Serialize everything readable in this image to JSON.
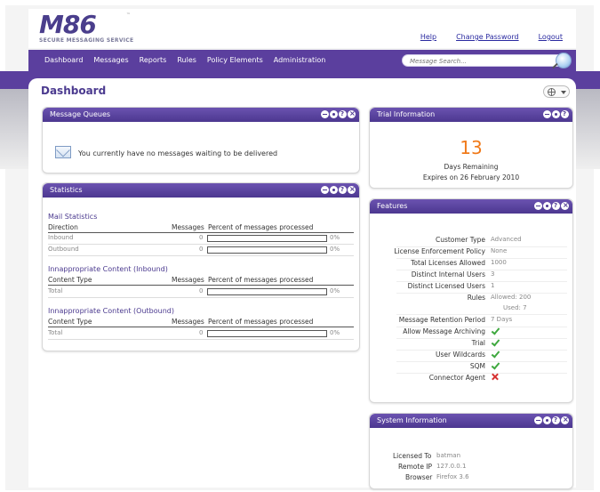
{
  "logo": {
    "mark": "M86",
    "tagline": "SECURE MESSAGING SERVICE",
    "tm": "™"
  },
  "top_links": {
    "help": "Help",
    "change_password": "Change Password",
    "logout": "Logout"
  },
  "nav": {
    "items": [
      "Dashboard",
      "Messages",
      "Reports",
      "Rules",
      "Policy Elements",
      "Administration"
    ],
    "search_placeholder": "Message Search..."
  },
  "page": {
    "title": "Dashboard"
  },
  "message_queues": {
    "title": "Message Queues",
    "message": "You currently have no messages waiting to be delivered"
  },
  "statistics": {
    "title": "Statistics",
    "mail": {
      "title": "Mail Statistics",
      "headers": {
        "direction": "Direction",
        "messages": "Messages",
        "percent": "Percent of messages processed"
      },
      "rows": [
        {
          "label": "Inbound",
          "messages": "0",
          "percent": 0,
          "percent_label": "0%"
        },
        {
          "label": "Outbound",
          "messages": "0",
          "percent": 0,
          "percent_label": "0%"
        }
      ]
    },
    "inbound_content": {
      "title": "Innappropriate Content (Inbound)",
      "headers": {
        "type": "Content Type",
        "messages": "Messages",
        "percent": "Percent of messages processed"
      },
      "rows": [
        {
          "label": "Total",
          "messages": "0",
          "percent": 0,
          "percent_label": "0%"
        }
      ]
    },
    "outbound_content": {
      "title": "Innappropriate Content (Outbound)",
      "headers": {
        "type": "Content Type",
        "messages": "Messages",
        "percent": "Percent of messages processed"
      },
      "rows": [
        {
          "label": "Total",
          "messages": "0",
          "percent": 0,
          "percent_label": "0%"
        }
      ]
    }
  },
  "trial": {
    "title": "Trial Information",
    "days": "13",
    "days_label": "Days Remaining",
    "expires": "Expires on 26 February 2010"
  },
  "features": {
    "title": "Features",
    "rows": [
      {
        "label": "Customer Type",
        "value": "Advanced"
      },
      {
        "label": "License Enforcement Policy",
        "value": "None"
      },
      {
        "label": "Total Licenses Allowed",
        "value": "1000"
      },
      {
        "label": "Distinct Internal Users",
        "value": "3"
      },
      {
        "label": "Distinct Licensed Users",
        "value": "1"
      },
      {
        "label": "Rules",
        "value": "Allowed: 200",
        "value2": "Used: 7"
      },
      {
        "label": "Message Retention Period",
        "value": "7 Days"
      },
      {
        "label": "Allow Message Archiving",
        "status": "yes"
      },
      {
        "label": "Trial",
        "status": "yes"
      },
      {
        "label": "User Wildcards",
        "status": "yes"
      },
      {
        "label": "SQM",
        "status": "yes"
      },
      {
        "label": "Connector Agent",
        "status": "no"
      }
    ]
  },
  "system": {
    "title": "System Information",
    "licensed_to_label": "Licensed To",
    "licensed_to": "batman",
    "remote_ip_label": "Remote IP",
    "remote_ip": "127.0.0.1",
    "browser_label": "Browser",
    "browser": "Firefox 3.6"
  },
  "colors": {
    "brand": "#5b3f9e",
    "accent": "#f07a1a",
    "link": "#2a2aa0",
    "ok": "#3ea83e",
    "error": "#d63030"
  }
}
